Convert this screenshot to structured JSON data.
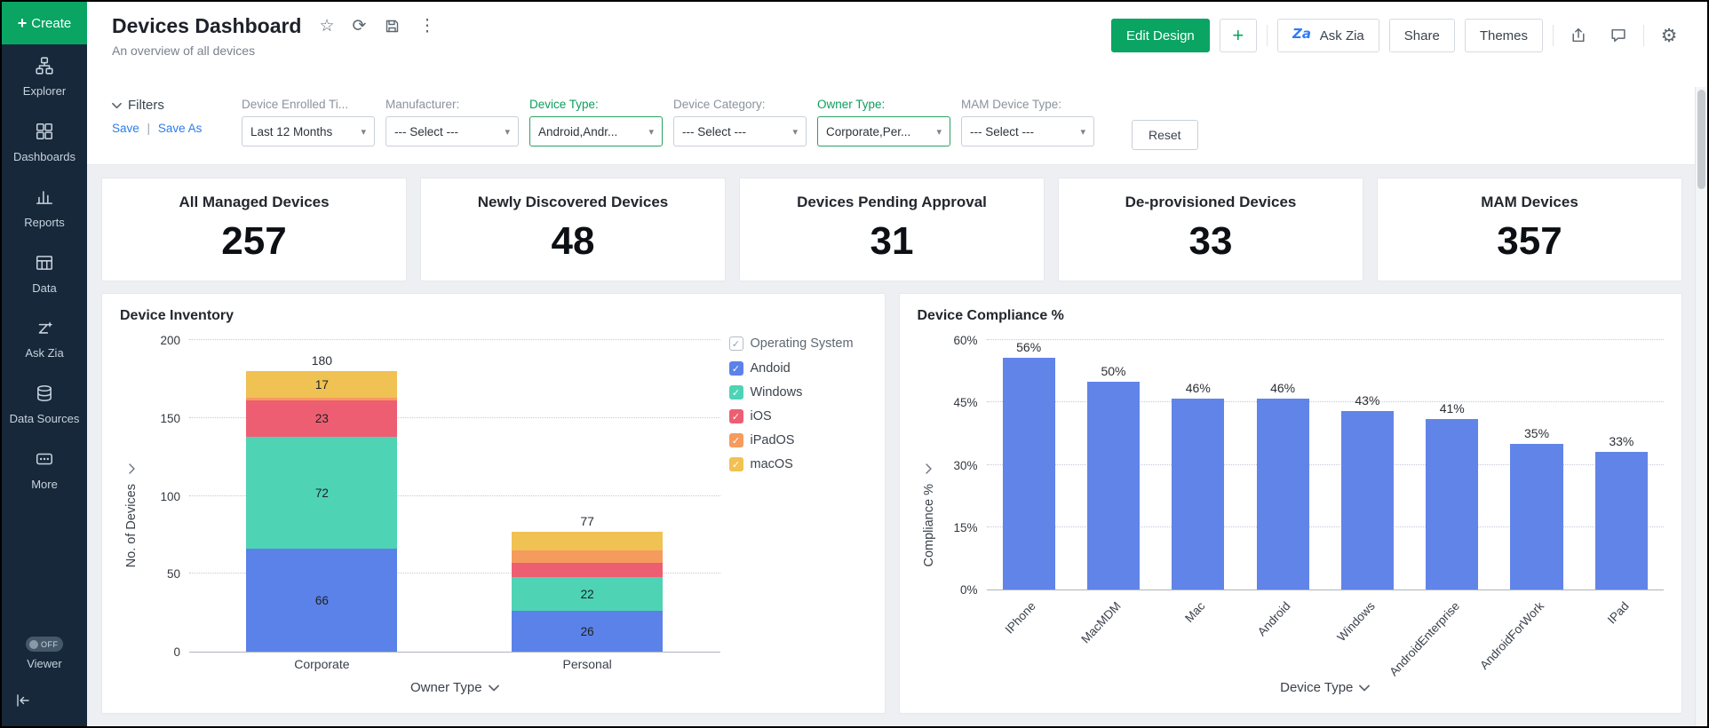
{
  "sidebar": {
    "create_label": "Create",
    "items": [
      {
        "label": "Explorer",
        "icon": "explorer-icon"
      },
      {
        "label": "Dashboards",
        "icon": "dashboards-icon"
      },
      {
        "label": "Reports",
        "icon": "reports-icon"
      },
      {
        "label": "Data",
        "icon": "data-icon"
      },
      {
        "label": "Ask Zia",
        "icon": "ask-zia-icon"
      },
      {
        "label": "Data Sources",
        "icon": "data-sources-icon"
      },
      {
        "label": "More",
        "icon": "more-icon"
      }
    ],
    "viewer": {
      "label": "Viewer",
      "toggle": "OFF"
    }
  },
  "header": {
    "title": "Devices Dashboard",
    "subtitle": "An overview of all devices",
    "edit_design": "Edit Design",
    "add": "+",
    "ask_zia": "Ask Zia",
    "share": "Share",
    "themes": "Themes"
  },
  "filters": {
    "title": "Filters",
    "save": "Save",
    "separator": "|",
    "save_as": "Save As",
    "reset": "Reset",
    "groups": [
      {
        "label": "Device Enrolled Ti...",
        "value": "Last 12 Months",
        "active": false
      },
      {
        "label": "Manufacturer:",
        "value": "--- Select ---",
        "active": false
      },
      {
        "label": "Device Type:",
        "value": "Android,Andr...",
        "active": true
      },
      {
        "label": "Device Category:",
        "value": "--- Select ---",
        "active": false
      },
      {
        "label": "Owner Type:",
        "value": "Corporate,Per...",
        "active": true
      },
      {
        "label": "MAM Device Type:",
        "value": "--- Select ---",
        "active": false
      }
    ]
  },
  "kpis": [
    {
      "label": "All Managed Devices",
      "value": "257"
    },
    {
      "label": "Newly Discovered Devices",
      "value": "48"
    },
    {
      "label": "Devices Pending Approval",
      "value": "31"
    },
    {
      "label": "De-provisioned Devices",
      "value": "33"
    },
    {
      "label": "MAM Devices",
      "value": "357"
    }
  ],
  "chart_data": [
    {
      "type": "bar",
      "stacked": true,
      "title": "Device Inventory",
      "categories": [
        "Corporate",
        "Personal"
      ],
      "series": [
        {
          "name": "Andoid",
          "color": "#5b82e8",
          "values": [
            66,
            26
          ]
        },
        {
          "name": "Windows",
          "color": "#4ed3b5",
          "values": [
            72,
            22
          ]
        },
        {
          "name": "iOS",
          "color": "#ee5e72",
          "values": [
            23,
            9
          ]
        },
        {
          "name": "iPadOS",
          "color": "#f59b5d",
          "values": [
            2,
            8
          ]
        },
        {
          "name": "macOS",
          "color": "#f0c153",
          "values": [
            17,
            12
          ]
        }
      ],
      "totals": [
        180,
        77
      ],
      "label_min": 15,
      "xlabel": "Owner Type",
      "ylabel": "No. of Devices",
      "ylim": [
        0,
        200
      ],
      "yticks": [
        0,
        50,
        100,
        150,
        200
      ],
      "legend_title": "Operating System",
      "legend_position": "right",
      "grid": "dotted"
    },
    {
      "type": "bar",
      "title": "Device Compliance %",
      "categories": [
        "IPhone",
        "MacMDM",
        "Mac",
        "Android",
        "Windows",
        "AndroidEnterprise",
        "AndroidForWork",
        "IPad"
      ],
      "values": [
        56,
        50,
        46,
        46,
        43,
        41,
        35,
        33
      ],
      "value_labels": [
        "56%",
        "50%",
        "46%",
        "46%",
        "43%",
        "41%",
        "35%",
        "33%"
      ],
      "bar_color": "#6184e8",
      "xlabel": "Device Type",
      "ylabel": "Compliance %",
      "ylim": [
        0,
        60
      ],
      "yticks": [
        0,
        15,
        30,
        45,
        60
      ],
      "ytick_labels": [
        "0%",
        "15%",
        "30%",
        "45%",
        "60%"
      ],
      "grid": "dotted"
    }
  ]
}
